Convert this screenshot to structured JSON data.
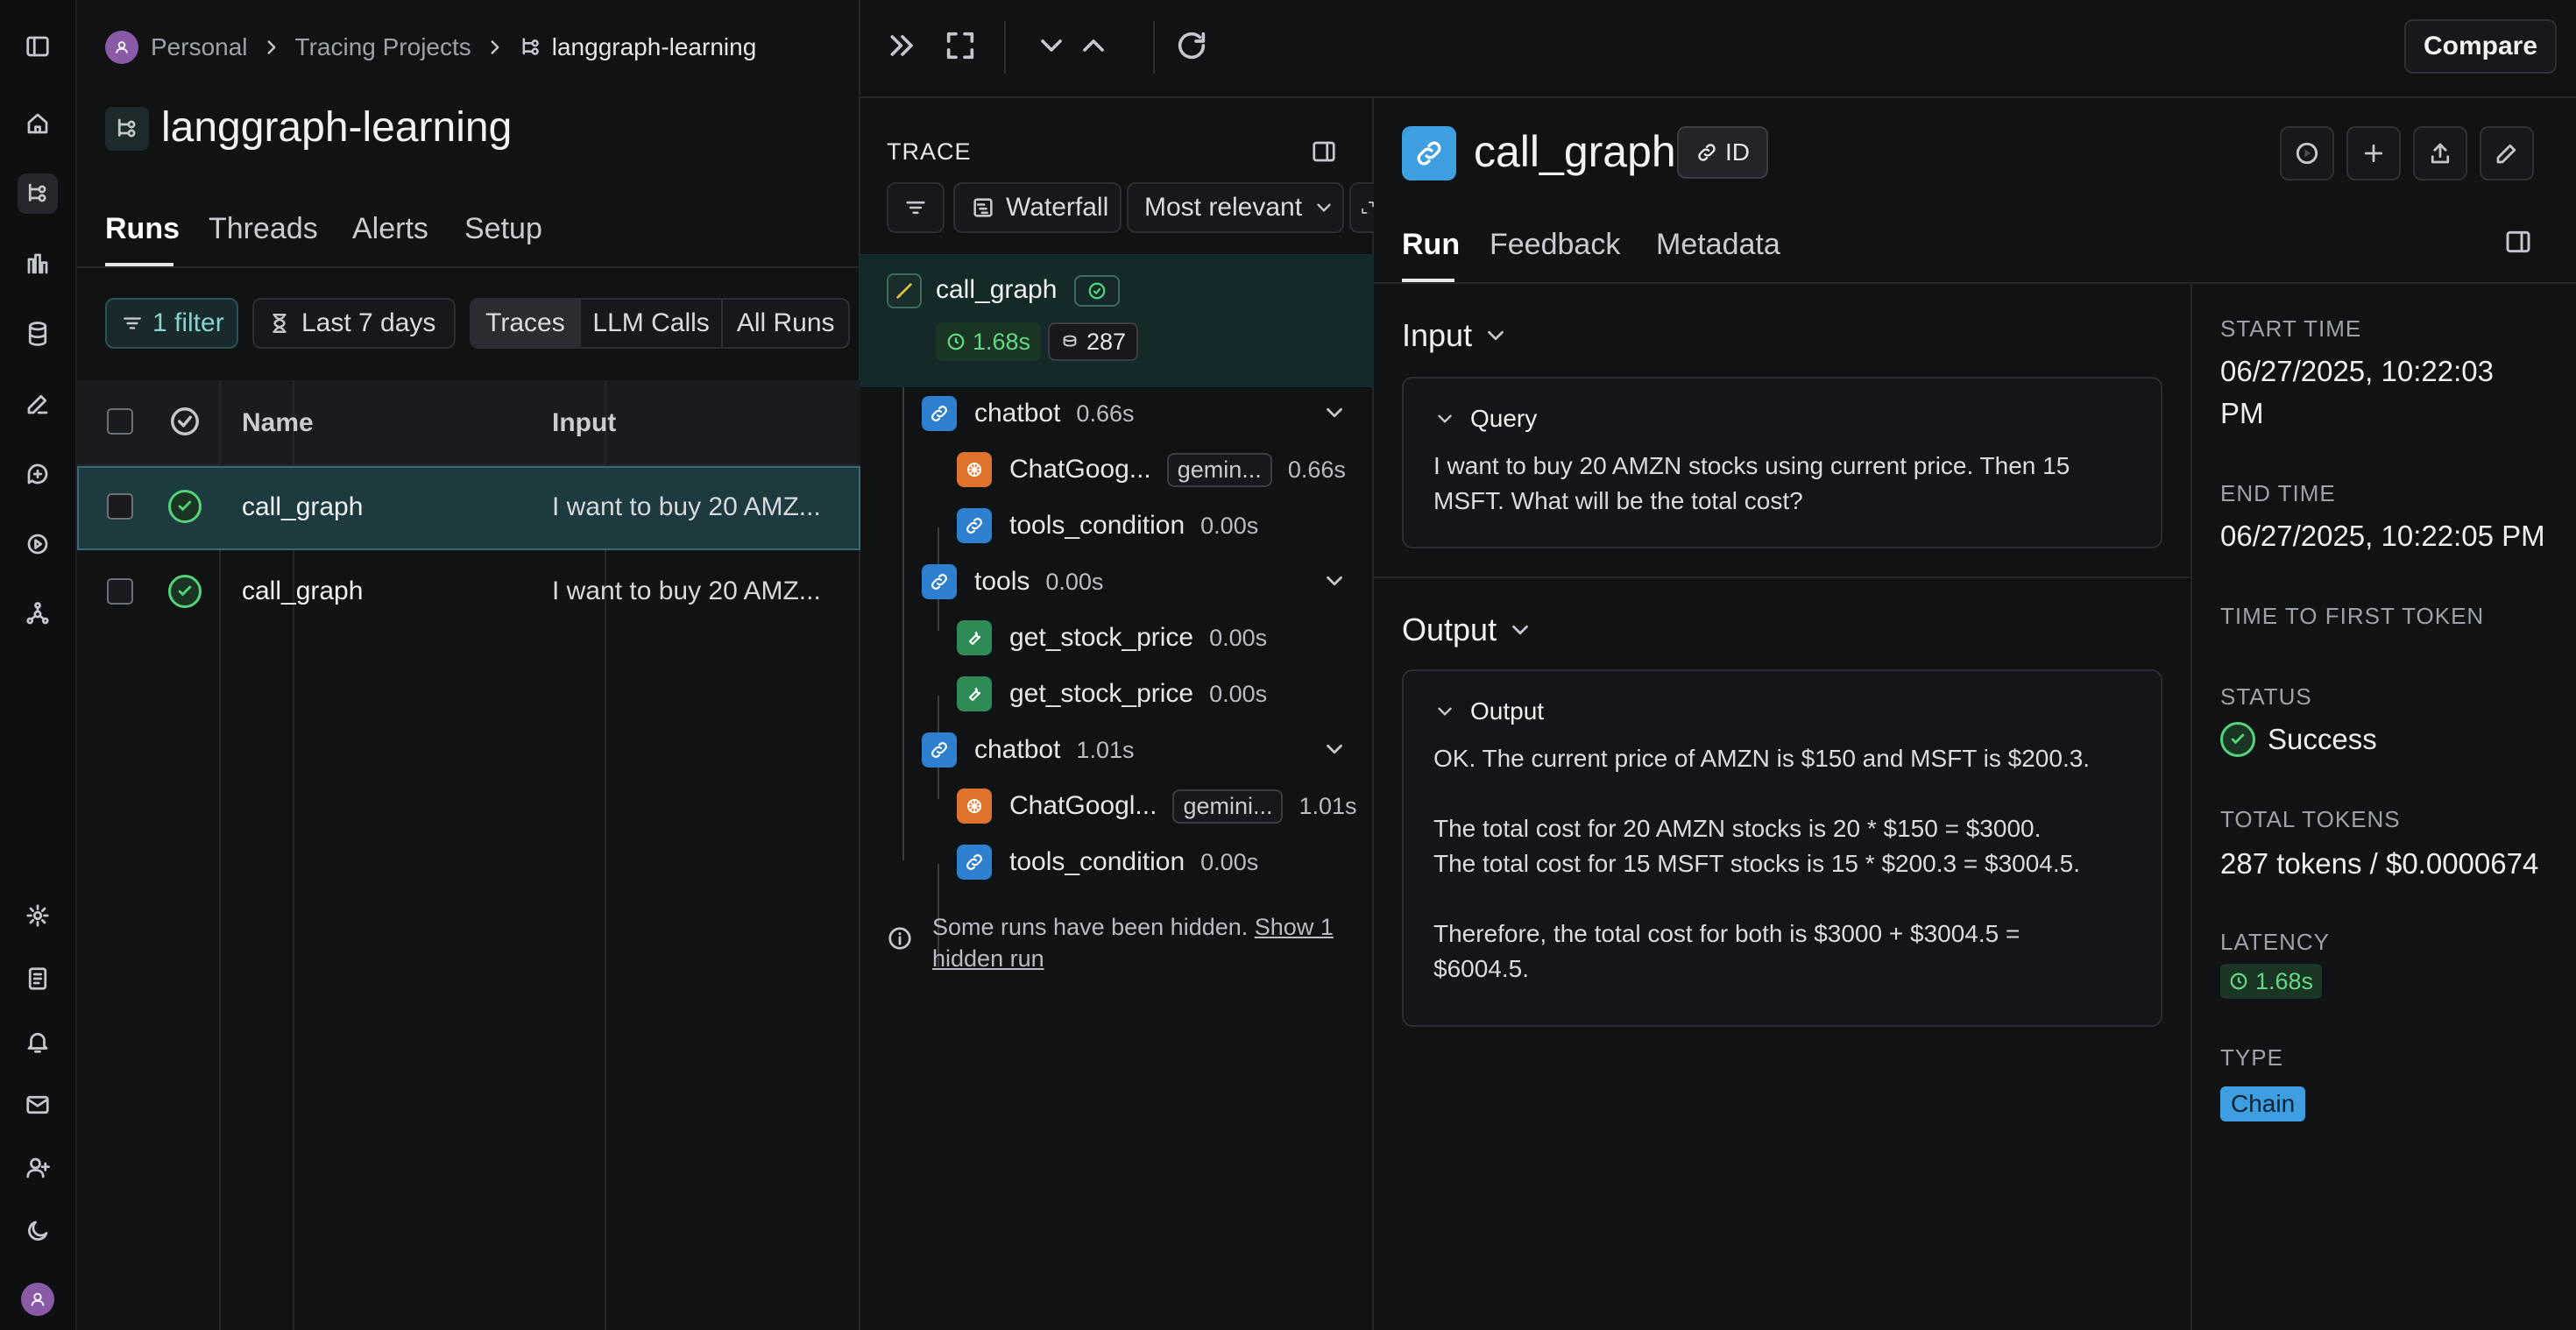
{
  "breadcrumb": {
    "workspace": "Personal",
    "section": "Tracing Projects",
    "project": "langgraph-learning"
  },
  "project_title": "langgraph-learning",
  "project_tabs": [
    "Runs",
    "Threads",
    "Alerts",
    "Setup"
  ],
  "filters": {
    "filter": "1 filter",
    "time": "Last 7 days",
    "types": [
      "Traces",
      "LLM Calls",
      "All Runs"
    ]
  },
  "table": {
    "headers": [
      "Name",
      "Input"
    ],
    "rows": [
      {
        "name": "call_graph",
        "input": "I want to buy 20 AMZ..."
      },
      {
        "name": "call_graph",
        "input": "I want to buy 20 AMZ..."
      }
    ]
  },
  "toolbar": {
    "compare": "Compare"
  },
  "trace": {
    "title": "TRACE",
    "view": "Waterfall",
    "sort": "Most relevant",
    "root": {
      "name": "call_graph",
      "latency": "1.68s",
      "tokens": "287"
    },
    "nodes": [
      {
        "name": "chatbot",
        "dur": "0.66s"
      },
      {
        "name": "ChatGoog...",
        "model": "gemin...",
        "dur": "0.66s"
      },
      {
        "name": "tools_condition",
        "dur": "0.00s"
      },
      {
        "name": "tools",
        "dur": "0.00s"
      },
      {
        "name": "get_stock_price",
        "dur": "0.00s"
      },
      {
        "name": "get_stock_price",
        "dur": "0.00s"
      },
      {
        "name": "chatbot",
        "dur": "1.01s"
      },
      {
        "name": "ChatGoogl...",
        "model": "gemini...",
        "dur": "1.01s"
      },
      {
        "name": "tools_condition",
        "dur": "0.00s"
      }
    ],
    "hidden_note": "Some runs have been hidden.",
    "hidden_link_1": "Show 1",
    "hidden_link_2": "hidden run"
  },
  "run": {
    "title": "call_graph",
    "id_label": "ID",
    "tabs": [
      "Run",
      "Feedback",
      "Metadata"
    ],
    "input_heading": "Input",
    "query_label": "Query",
    "query_text": "I want to buy 20 AMZN stocks using current price. Then 15 MSFT. What will be the total cost?",
    "output_heading": "Output",
    "output_label": "Output",
    "output_lines": [
      "OK. The current price of AMZN is $150 and MSFT is $200.3.",
      "",
      "The total cost for 20 AMZN stocks is 20 * $150 = $3000.",
      "The total cost for 15 MSFT stocks is 15 * $200.3 = $3004.5.",
      "",
      "Therefore, the total cost for both is $3000 + $3004.5 =",
      "$6004.5."
    ]
  },
  "meta": {
    "start_label": "START TIME",
    "start_value_1": "06/27/2025, 10:22:03",
    "start_value_2": "PM",
    "end_label": "END TIME",
    "end_value": "06/27/2025, 10:22:05 PM",
    "ttft_label": "TIME TO FIRST TOKEN",
    "status_label": "STATUS",
    "status_value": "Success",
    "tokens_label": "TOTAL TOKENS",
    "tokens_value": "287 tokens / $0.0000674",
    "latency_label": "LATENCY",
    "latency_value": "1.68s",
    "type_label": "TYPE",
    "type_value": "Chain"
  },
  "colors": {
    "accent_blue": "#2f7fd0",
    "success": "#55d37a",
    "selected_row": "#1d3a3e",
    "chain_badge": "#3d9ee0"
  }
}
